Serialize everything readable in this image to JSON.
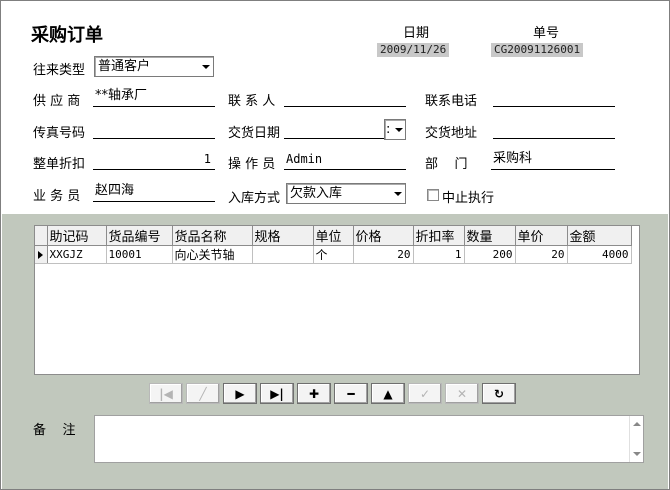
{
  "form": {
    "title": "采购订单",
    "date_label": "日期",
    "date_value": "2009/11/26",
    "order_no_label": "单号",
    "order_no_value": "CG20091126001"
  },
  "fields": {
    "partner_type_label": "往来类型",
    "partner_type_value": "普通客户",
    "supplier_label": "供 应 商",
    "supplier_value": "**轴承厂",
    "contact_label": "联 系 人",
    "contact_value": "",
    "phone_label": "联系电话",
    "phone_value": "",
    "fax_label": "传真号码",
    "fax_value": "",
    "delivery_date_label": "交货日期",
    "delivery_date_value": ":",
    "delivery_addr_label": "交货地址",
    "delivery_addr_value": "",
    "discount_label": "整单折扣",
    "discount_value": "1",
    "operator_label": "操 作 员",
    "operator_value": "Admin",
    "dept_label": "部    门",
    "dept_value": "采购科",
    "clerk_label": "业 务 员",
    "clerk_value": "赵四海",
    "stock_mode_label": "入库方式",
    "stock_mode_value": "欠款入库",
    "suspend_label": "中止执行",
    "suspend_checked": false
  },
  "grid": {
    "columns": [
      "助记码",
      "货品编号",
      "货品名称",
      "规格",
      "单位",
      "价格",
      "折扣率",
      "数量",
      "单价",
      "金额"
    ],
    "rows": [
      [
        "XXGJZ",
        "10001",
        "向心关节轴",
        "",
        "个",
        "20",
        "1",
        "200",
        "20",
        "4000"
      ]
    ]
  },
  "nav": {
    "first": "|◀",
    "edit": "╱",
    "next": "▶",
    "last": "▶|",
    "add": "✚",
    "remove": "━",
    "up": "▲",
    "check": "✓",
    "cancel": "✕",
    "refresh": "↻"
  },
  "remark": {
    "label": "备    注",
    "value": ""
  }
}
